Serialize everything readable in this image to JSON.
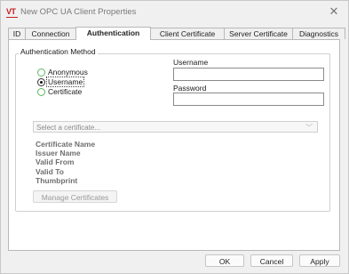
{
  "window": {
    "title": "New OPC UA Client Properties",
    "app_icon_text": "VT"
  },
  "tabs": [
    {
      "label": "ID"
    },
    {
      "label": "Connection"
    },
    {
      "label": "Authentication",
      "active": true
    },
    {
      "label": "Client Certificate"
    },
    {
      "label": "Server Certificate"
    },
    {
      "label": "Diagnostics"
    }
  ],
  "auth": {
    "group_label": "Authentication Method",
    "options": [
      "Anonymous",
      "Username",
      "Certificate"
    ],
    "selected": "Username",
    "username_label": "Username",
    "username_value": "",
    "password_label": "Password",
    "password_value": ""
  },
  "certificate": {
    "select_placeholder": "Select a certificate...",
    "labels": [
      "Certificate Name",
      "Issuer Name",
      "Valid From",
      "Valid To",
      "Thumbprint"
    ],
    "manage_button": "Manage Certificates"
  },
  "footer": {
    "ok": "OK",
    "cancel": "Cancel",
    "apply": "Apply"
  }
}
